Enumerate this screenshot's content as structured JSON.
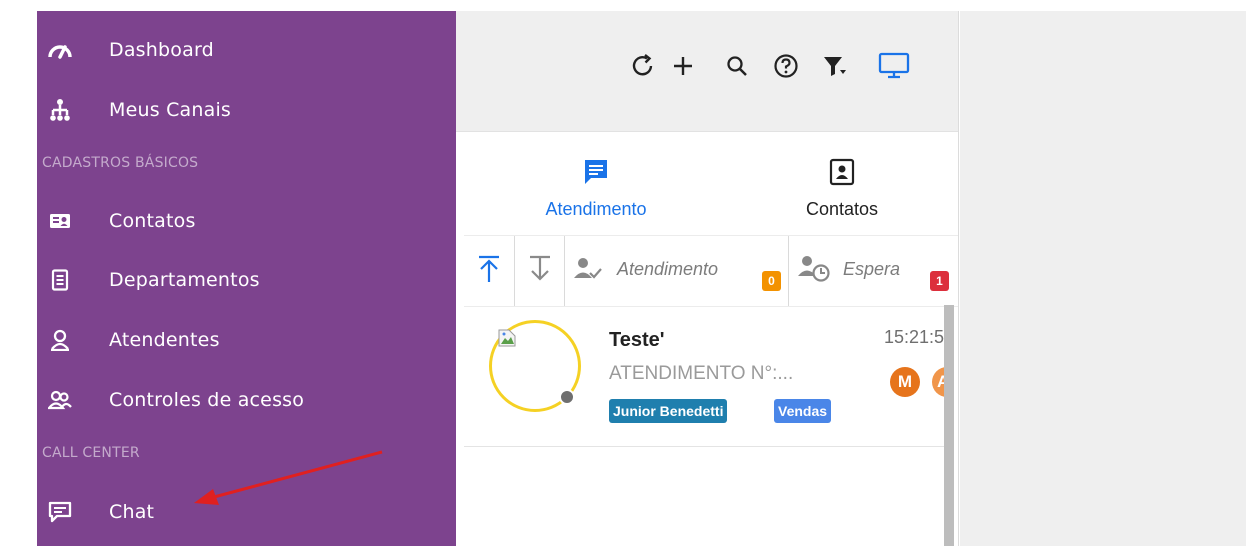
{
  "sidebar": {
    "items": [
      {
        "label": "Dashboard",
        "icon": "speedometer-icon"
      },
      {
        "label": "Meus Canais",
        "icon": "sitemap-icon"
      },
      {
        "label": "Contatos",
        "icon": "contact-card-icon"
      },
      {
        "label": "Departamentos",
        "icon": "document-list-icon"
      },
      {
        "label": "Atendentes",
        "icon": "user-icon"
      },
      {
        "label": "Controles de acesso",
        "icon": "users-icon"
      },
      {
        "label": "Chat",
        "icon": "chat-icon"
      }
    ],
    "sections": {
      "cadastros": "CADASTROS BÁSICOS",
      "call_center": "CALL CENTER"
    },
    "colors": {
      "background": "#7d438e",
      "text": "#ffffff"
    }
  },
  "toolbar": {
    "icons": [
      "refresh-icon",
      "plus-icon",
      "search-icon",
      "help-icon",
      "filter-icon",
      "monitor-icon"
    ],
    "accent": "#1a73e8"
  },
  "tabs": {
    "atendimento": "Atendimento",
    "contatos": "Contatos",
    "active_color": "#1a73e8"
  },
  "filters": {
    "atendimento_label": "Atendimento",
    "atendimento_count": "0",
    "espera_label": "Espera",
    "espera_count": "1",
    "colors": {
      "orange": "#f39200",
      "red": "#dc2f3c"
    }
  },
  "conversation": {
    "name": "Teste'",
    "subtitle": "ATENDIMENTO N°:...",
    "time": "15:21:5",
    "tags": [
      "Junior Benedetti",
      "Vendas"
    ],
    "badges": [
      "M",
      "A"
    ],
    "colors": {
      "ring": "#f5d124",
      "tag1": "#1f7fae",
      "tag2": "#4a86e8",
      "badge": "#e6741c"
    }
  },
  "annotation": {
    "arrow_color": "#e02020"
  }
}
